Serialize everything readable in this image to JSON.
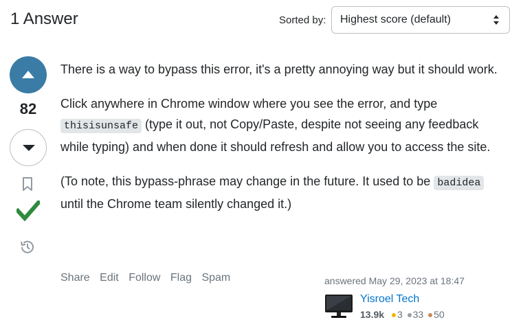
{
  "header": {
    "title": "1 Answer",
    "sort_label": "Sorted by:",
    "sort_value": "Highest score (default)"
  },
  "votes": {
    "score": "82"
  },
  "post": {
    "p1": "There is a way to bypass this error, it's a pretty annoying way but it should work.",
    "p2_before": "Click anywhere in Chrome window where you see the error, and type ",
    "p2_code": "thisisunsafe",
    "p2_after": " (type it out, not Copy/Paste, despite not seeing any feedback while typing) and when done it should refresh and allow you to access the site.",
    "p3_before": "(To note, this bypass-phrase may change in the future. It used to be ",
    "p3_code": "badidea",
    "p3_after": " until the Chrome team silently changed it.)"
  },
  "actions": [
    "Share",
    "Edit",
    "Follow",
    "Flag",
    "Spam"
  ],
  "author": {
    "answered_text": "answered May 29, 2023 at 18:47",
    "name": "Yisroel Tech",
    "reputation": "13.9k",
    "gold": "3",
    "silver": "33",
    "bronze": "50"
  },
  "colors": {
    "upvote_bg": "#3a7ca5",
    "accepted_check": "#2f8a3d",
    "gold": "#f1b600",
    "silver": "#9a9ea2",
    "bronze": "#c7895a",
    "link": "#0074cc"
  },
  "icons": {
    "sort": "sort-arrows-icon",
    "upvote": "arrow-up-icon",
    "downvote": "arrow-down-icon",
    "bookmark": "bookmark-icon",
    "accepted": "checkmark-icon",
    "history": "history-icon"
  }
}
